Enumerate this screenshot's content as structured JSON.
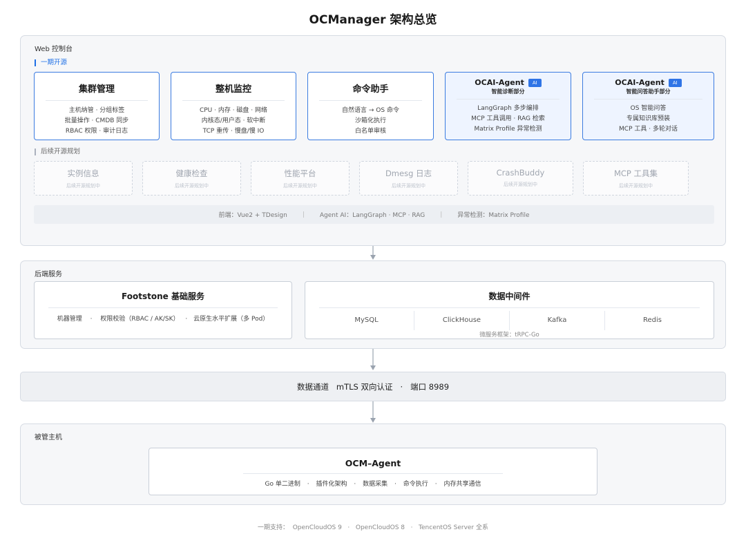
{
  "title": "OCManager 架构总览",
  "web": {
    "label": "Web 控制台",
    "phase1_label": "一期开源",
    "cards": [
      {
        "title": "集群管理",
        "lines": [
          "主机纳管 · 分组标签",
          "批量操作 · CMDB 同步",
          "RBAC 权限 · 审计日志"
        ]
      },
      {
        "title": "整机监控",
        "lines": [
          "CPU · 内存 · 磁盘 · 网络",
          "内核态/用户态 · 软中断",
          "TCP 重传 · 慢盘/慢 IO"
        ]
      },
      {
        "title": "命令助手",
        "lines": [
          "自然语言 → OS 命令",
          "沙箱化执行",
          "白名单审核"
        ]
      }
    ],
    "ai_cards": [
      {
        "title": "OCAI-Agent",
        "badge": "AI",
        "subtitle": "智能诊断部分",
        "lines": [
          "LangGraph 多步编排",
          "MCP 工具调用 · RAG 检索",
          "Matrix Profile 异常检测"
        ]
      },
      {
        "title": "OCAI-Agent",
        "badge": "AI",
        "subtitle": "智能问答助手部分",
        "lines": [
          "OS 智能问答",
          "专属知识库预装",
          "MCP 工具 · 多轮对话"
        ]
      }
    ],
    "planned_label": "后续开源规划",
    "planned": [
      {
        "name": "实例信息",
        "sub": "后续开源规划中"
      },
      {
        "name": "健康检查",
        "sub": "后续开源规划中"
      },
      {
        "name": "性能平台",
        "sub": "后续开源规划中"
      },
      {
        "name": "Dmesg 日志",
        "sub": "后续开源规划中"
      },
      {
        "name": "CrashBuddy",
        "sub": "后续开源规划中"
      },
      {
        "name": "MCP 工具集",
        "sub": "后续开源规划中"
      }
    ],
    "tech": [
      "前端：Vue2 + TDesign",
      "Agent AI：LangGraph · MCP · RAG",
      "异常检测：Matrix Profile"
    ],
    "tech_sep": "|"
  },
  "backend": {
    "label": "后端服务",
    "footstone": {
      "title": "Footstone 基础服务",
      "items": [
        "机器管理",
        "权限校验（RBAC / AK/SK）",
        "云原生水平扩展（多 Pod）"
      ]
    },
    "middleware": {
      "title": "数据中间件",
      "items": [
        "MySQL",
        "ClickHouse",
        "Kafka",
        "Redis"
      ],
      "note": "微服务框架：tRPC-Go"
    }
  },
  "channel": {
    "text": "数据通道   mTLS 双向认证   ·   端口 8989"
  },
  "hosts": {
    "label": "被管主机",
    "agent": {
      "title": "OCM–Agent",
      "items": [
        "Go 单二进制",
        "插件化架构",
        "数据采集",
        "命令执行",
        "内存共享通信"
      ]
    }
  },
  "footer": "一期支持：  OpenCloudOS 9   ·   OpenCloudOS 8   ·   TencentOS Server 全系",
  "colors": {
    "accent": "#1d6fe6",
    "card_border": "#3a7be0",
    "ai_bg": "#eef4ff",
    "section_bg": "#f6f7f9"
  },
  "icons": {
    "badge": "ai-badge",
    "arrow": "down-arrow-icon"
  }
}
